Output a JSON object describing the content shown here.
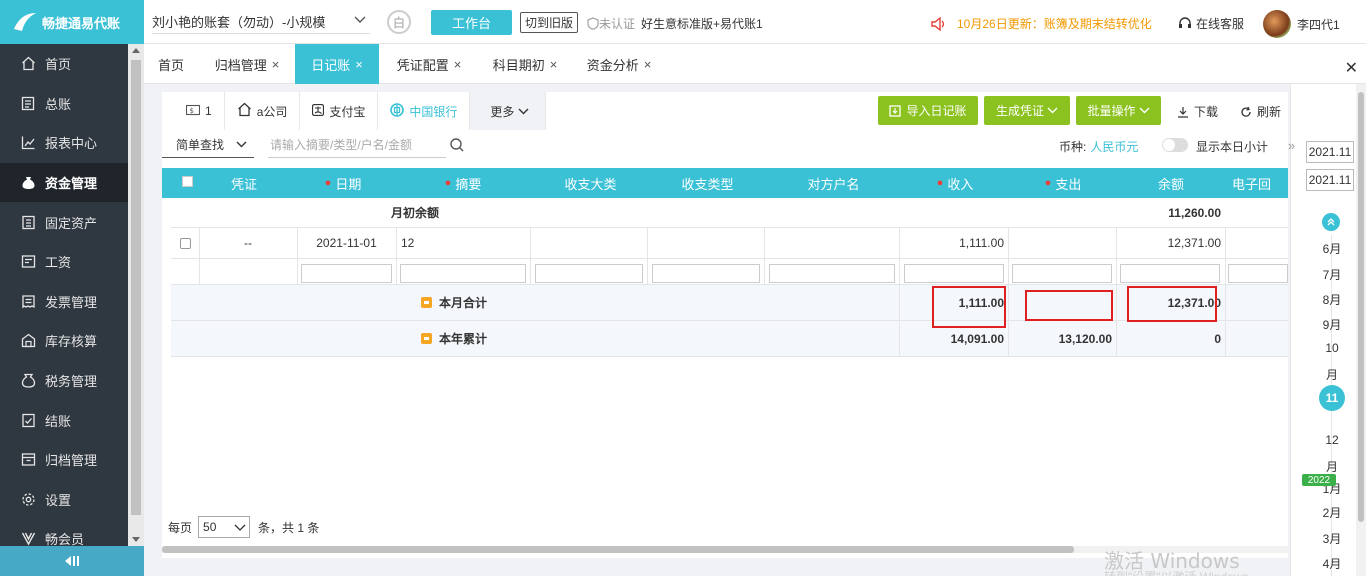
{
  "app": {
    "logo_text": "畅捷通易代账"
  },
  "sidebar": {
    "items": [
      {
        "label": "首页",
        "icon": "home-icon"
      },
      {
        "label": "总账",
        "icon": "ledger-icon"
      },
      {
        "label": "报表中心",
        "icon": "chart-icon"
      },
      {
        "label": "资金管理",
        "icon": "money-bag-icon",
        "active": true
      },
      {
        "label": "固定资产",
        "icon": "building-icon"
      },
      {
        "label": "工资",
        "icon": "payroll-icon"
      },
      {
        "label": "发票管理",
        "icon": "invoice-icon"
      },
      {
        "label": "库存核算",
        "icon": "warehouse-icon"
      },
      {
        "label": "税务管理",
        "icon": "tax-icon"
      },
      {
        "label": "结账",
        "icon": "checkout-icon"
      },
      {
        "label": "归档管理",
        "icon": "archive-icon"
      },
      {
        "label": "设置",
        "icon": "gear-icon"
      },
      {
        "label": "畅会员",
        "icon": "vip-icon"
      }
    ]
  },
  "topbar": {
    "account_name": "刘小艳的账套（勿动）-小规模",
    "round_icon_char": "白",
    "workbench_label": "工作台",
    "old_version_label": "切到旧版",
    "cert_status": "未认证",
    "plan_name": "好生意标准版+易代账1",
    "notice": "10月26日更新：账簿及期末结转优化",
    "service_label": "在线客服",
    "user_name": "李四代1"
  },
  "tabs": [
    {
      "label": "首页",
      "closable": false
    },
    {
      "label": "归档管理",
      "closable": true
    },
    {
      "label": "日记账",
      "closable": true,
      "active": true
    },
    {
      "label": "凭证配置",
      "closable": true
    },
    {
      "label": "科目期初",
      "closable": true
    },
    {
      "label": "资金分析",
      "closable": true
    }
  ],
  "account_tabs": [
    {
      "label": "1",
      "icon": "cash-icon"
    },
    {
      "label": "a公司",
      "icon": "home-icon"
    },
    {
      "label": "支付宝",
      "icon": "alipay-icon"
    },
    {
      "label": "中国银行",
      "icon": "bank-of-china-icon",
      "active": true
    },
    {
      "label": "更多",
      "icon": "chevron-down-icon"
    }
  ],
  "actions": {
    "import_label": "导入日记账",
    "gen_voucher_label": "生成凭证",
    "batch_label": "批量操作",
    "download_label": "下载",
    "refresh_label": "刷新"
  },
  "filter": {
    "search_type": "简单查找",
    "search_placeholder": "请输入摘要/类型/户名/金额",
    "currency_label": "币种:",
    "currency_value": "人民币元",
    "daily_subtotal_label": "显示本日小计"
  },
  "table": {
    "headers": [
      "凭证",
      "日期",
      "摘要",
      "收支大类",
      "收支类型",
      "对方户名",
      "收入",
      "支出",
      "余额",
      "电子回"
    ],
    "opening": {
      "label": "月初余额",
      "balance": "11,260.00"
    },
    "rows": [
      {
        "voucher": "--",
        "date": "2021-11-01",
        "summary": "12",
        "category": "",
        "type": "",
        "counterparty": "",
        "income": "1,111.00",
        "expense": "",
        "balance": "12,371.00"
      }
    ],
    "month_total": {
      "label": "本月合计",
      "income": "1,111.00",
      "expense": "",
      "balance": "12,371.00"
    },
    "year_total": {
      "label": "本年累计",
      "income": "14,091.00",
      "expense": "13,120.00",
      "balance": "0"
    }
  },
  "pager": {
    "per_page_label": "每页",
    "per_page": "50",
    "total_text": "条，共 1 条"
  },
  "date_range": {
    "start": "2021.11",
    "end": "2021.11"
  },
  "timeline": {
    "months": [
      "6月",
      "7月",
      "8月",
      "9月",
      "10",
      "月",
      "11",
      "12",
      "月",
      "1月",
      "2月",
      "3月",
      "4月"
    ],
    "current": "11",
    "year_badge": "2022"
  },
  "watermark": {
    "line1": "激活 Windows",
    "line2": "转到\"设置\"以激活 Windows。"
  },
  "colors": {
    "accent": "#3bc1d6",
    "green": "#8cc21f",
    "highlight": "#e02020",
    "notice": "#f39800"
  }
}
